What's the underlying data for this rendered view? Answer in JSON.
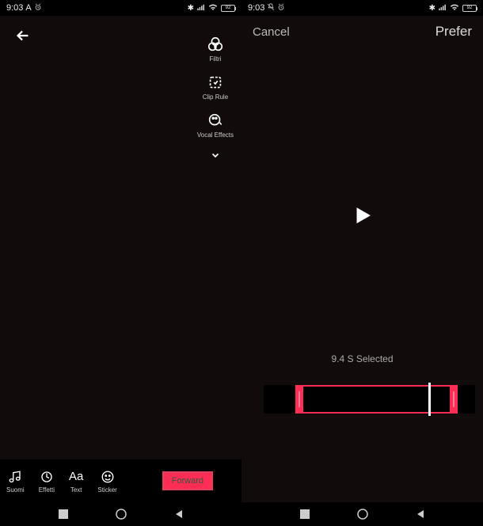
{
  "status": {
    "time": "9:03",
    "am_indicator": "A",
    "alarm": "⏰",
    "bluetooth": "✱",
    "signal": "📶",
    "wifi": "📶",
    "battery": "92"
  },
  "left_screen": {
    "side_tools": {
      "filters": {
        "label": "Filtri"
      },
      "clip_rule": {
        "label": "Clip Rule"
      },
      "vocal_effects": {
        "label": "Vocal Effects"
      }
    },
    "bottom_tools": {
      "suomi": {
        "label": "Suomi"
      },
      "effetti": {
        "label": "Effetti"
      },
      "text": {
        "label": "Text"
      },
      "sticker": {
        "label": "Sticker"
      }
    },
    "forward_label": "Forward"
  },
  "right_screen": {
    "cancel_label": "Cancel",
    "prefer_label": "Prefer",
    "selection_text": "9.4 S Selected"
  }
}
